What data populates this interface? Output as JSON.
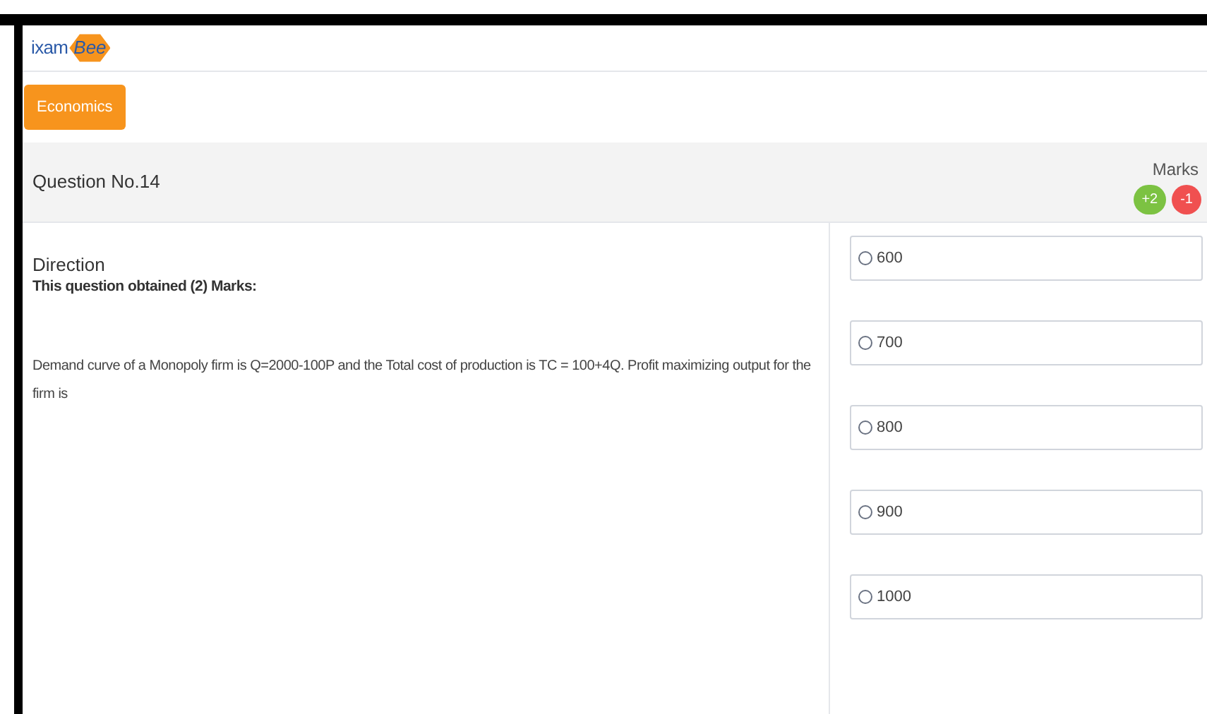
{
  "logo": {
    "text": "ixam",
    "mark": "Bee"
  },
  "subject_button": "Economics",
  "question": {
    "title": "Question No.14",
    "marks_label": "Marks",
    "marks": [
      {
        "text": "+2",
        "color": "#7cc242"
      },
      {
        "text": "-1",
        "color": "#f05050"
      }
    ]
  },
  "direction": {
    "heading": "Direction",
    "obtained": "This question obtained (2) Marks:",
    "text": "Demand curve of a Monopoly firm is Q=2000-100P and the Total cost of production is TC = 100+4Q. Profit maximizing output for the firm is"
  },
  "options": [
    {
      "label": "600",
      "selected": false
    },
    {
      "label": "700",
      "selected": false
    },
    {
      "label": "800",
      "selected": false
    },
    {
      "label": "900",
      "selected": false
    },
    {
      "label": "1000",
      "selected": false
    }
  ]
}
